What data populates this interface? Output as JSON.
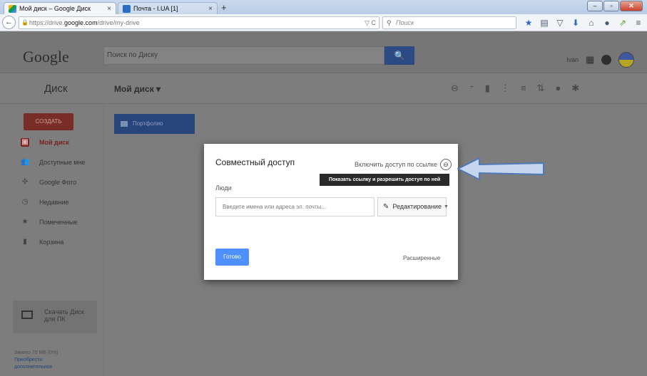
{
  "browser": {
    "tabs": [
      {
        "label": "Мой диск – Google Диск",
        "close": "×"
      },
      {
        "label": "Почта - I.UA [1]",
        "close": "×"
      }
    ],
    "new_tab": "+",
    "window_buttons": {
      "minimize": "–",
      "maximize": "▫",
      "close": "✕"
    },
    "url": {
      "prefix": "https://drive.",
      "host": "google.com",
      "path": "/drive/my-drive"
    },
    "url_right_icons": "▽ C",
    "search_placeholder": "Поиск",
    "nav_icons": [
      "star-icon",
      "bookmarks-icon",
      "pocket-icon",
      "download-icon",
      "home-icon",
      "chat-icon",
      "share-icon",
      "menu-icon"
    ]
  },
  "drive": {
    "logo": "Google",
    "search_placeholder": "Поиск по Диску",
    "search_button": "🔍",
    "user_name": "Ivan",
    "app_title": "Диск",
    "location": "Мой диск ▾",
    "toolbar_icons": [
      "link-icon",
      "add-person-icon",
      "trash-icon",
      "more-icon",
      "list-view-icon",
      "sort-icon",
      "info-icon",
      "settings-icon"
    ],
    "create_button": "СОЗДАТЬ",
    "nav": [
      {
        "label": "Мой диск",
        "icon": "▣",
        "active": true
      },
      {
        "label": "Доступные мне",
        "icon": "👥",
        "active": false
      },
      {
        "label": "Google Фото",
        "icon": "✣",
        "active": false
      },
      {
        "label": "Недавние",
        "icon": "◷",
        "active": false
      },
      {
        "label": "Помеченные",
        "icon": "★",
        "active": false
      },
      {
        "label": "Корзина",
        "icon": "▮",
        "active": false
      }
    ],
    "download_line1": "Скачать Диск",
    "download_line2": "для ПК",
    "storage_used": "Занято 70 МБ (0%)",
    "storage_buy1": "Приобрести",
    "storage_buy2": "дополнительное",
    "folder_name": "Портфолио"
  },
  "dialog": {
    "title": "Совместный доступ",
    "share_link_label": "Включить доступ по ссылке",
    "tooltip": "Показать ссылку и разрешить доступ по ней",
    "people_label": "Люди",
    "people_placeholder": "Введите имена или адреса эл. почты...",
    "permission": "Редактирование",
    "done_button": "Готово",
    "advanced_link": "Расширенные"
  },
  "colors": {
    "accent": "#4d90fe",
    "arrow_fill": "#c5d6ee",
    "arrow_stroke": "#4f79b8"
  }
}
